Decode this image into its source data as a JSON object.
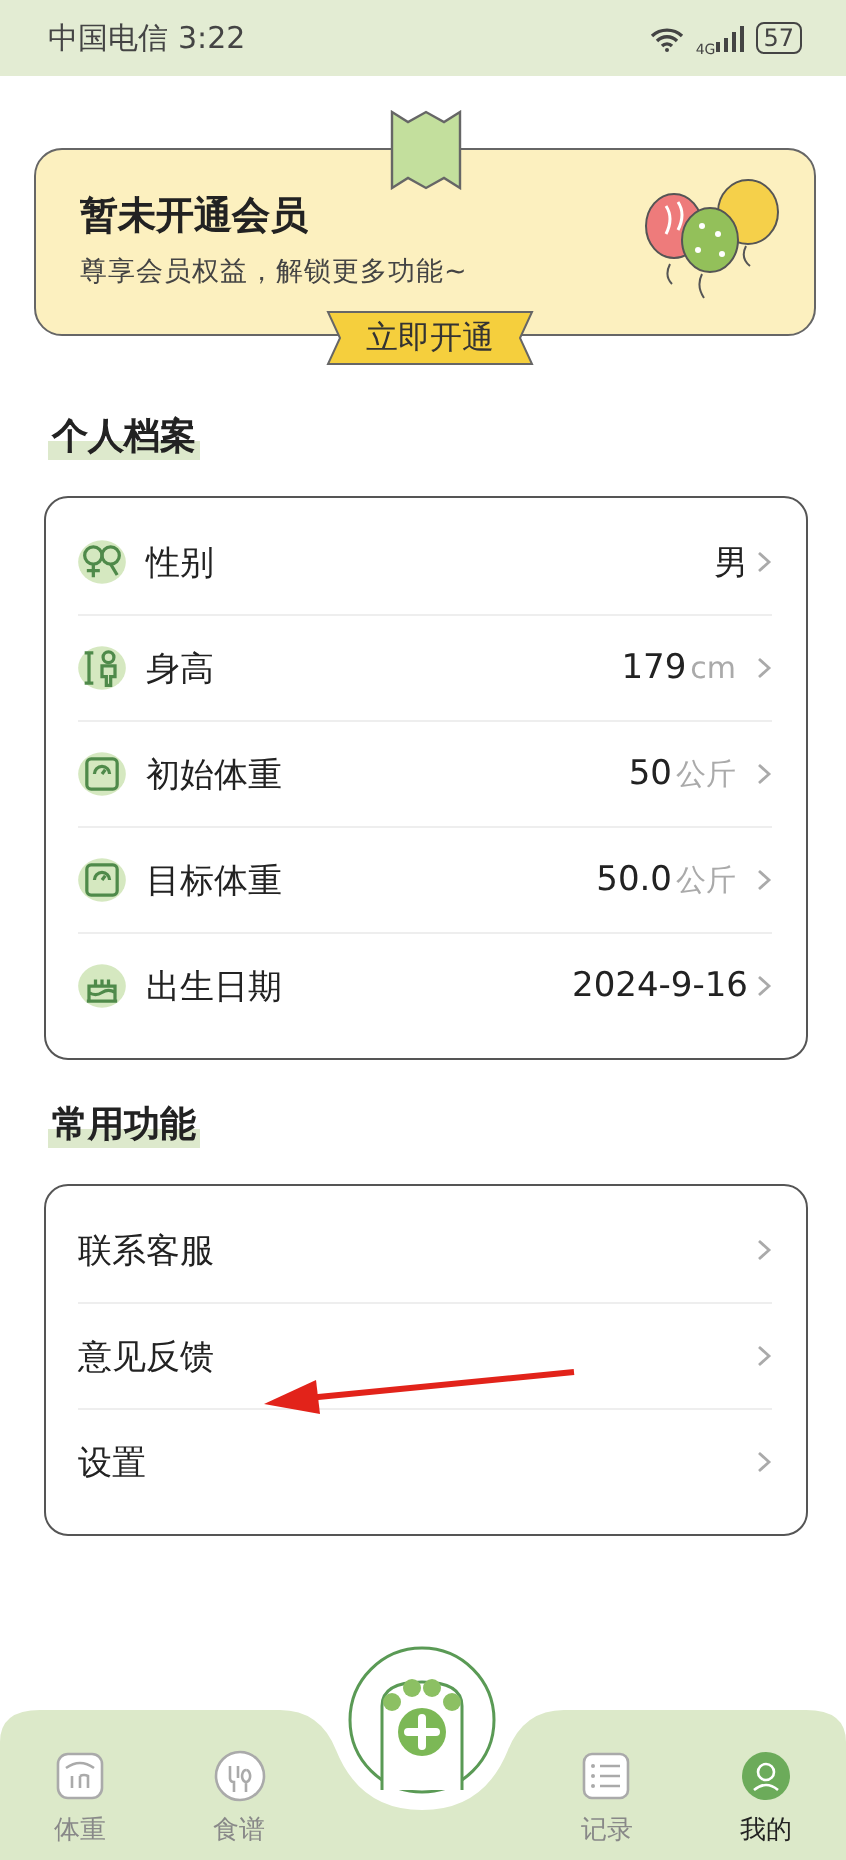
{
  "status_bar": {
    "carrier": "中国电信",
    "time": "3:22",
    "network": "4G",
    "battery": "57"
  },
  "member_card": {
    "title": "暂未开通会员",
    "subtitle": "尊享会员权益，解锁更多功能~",
    "button": "立即开通"
  },
  "profile": {
    "title": "个人档案",
    "rows": [
      {
        "kind": "gender",
        "label": "性别",
        "value": "男"
      },
      {
        "kind": "height",
        "label": "身高",
        "value": "179",
        "unit": "cm"
      },
      {
        "kind": "scale",
        "label": "初始体重",
        "value": "50",
        "unit": "公斤"
      },
      {
        "kind": "scale",
        "label": "目标体重",
        "value": "50.0",
        "unit": "公斤"
      },
      {
        "kind": "cake",
        "label": "出生日期",
        "value": "2024-9-16"
      }
    ]
  },
  "functions": {
    "title": "常用功能",
    "rows": [
      {
        "label": "联系客服"
      },
      {
        "label": "意见反馈"
      },
      {
        "label": "设置"
      }
    ]
  },
  "tab_bar": {
    "tabs": [
      {
        "kind": "weight",
        "label": "体重",
        "selected": false
      },
      {
        "kind": "recipe",
        "label": "食谱",
        "selected": false
      },
      {
        "kind": "record",
        "label": "记录",
        "selected": false
      },
      {
        "kind": "me",
        "label": "我的",
        "selected": true
      }
    ]
  }
}
